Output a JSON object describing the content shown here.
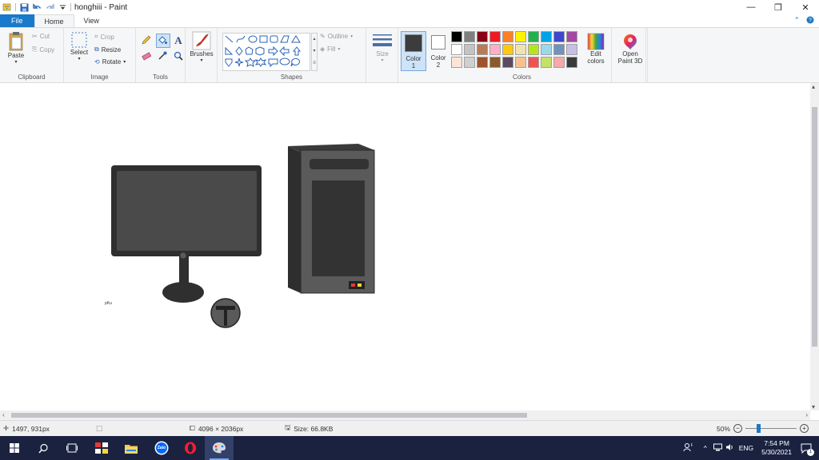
{
  "app": {
    "title": "honghiii - Paint"
  },
  "quick_access": {
    "icons": [
      "paint-app-icon",
      "save-icon",
      "undo-icon",
      "redo-icon",
      "customize-icon"
    ]
  },
  "window_controls": {
    "minimize": "—",
    "restore": "❐",
    "close": "✕"
  },
  "tabs": [
    {
      "label": "File"
    },
    {
      "label": "Home"
    },
    {
      "label": "View"
    }
  ],
  "ribbon": {
    "clipboard": {
      "label": "Clipboard",
      "paste": "Paste",
      "cut": "Cut",
      "copy": "Copy"
    },
    "image": {
      "label": "Image",
      "select": "Select",
      "crop": "Crop",
      "resize": "Resize",
      "rotate": "Rotate"
    },
    "tools": {
      "label": "Tools"
    },
    "brushes": {
      "label": "Brushes"
    },
    "shapes": {
      "label": "Shapes",
      "outline": "Outline",
      "fill": "Fill"
    },
    "size": {
      "label": "Size"
    },
    "colors": {
      "label": "Colors",
      "color1": "Color",
      "color1_num": "1",
      "color2": "Color",
      "color2_num": "2",
      "edit_colors_line1": "Edit",
      "edit_colors_line2": "colors",
      "color1_value": "#3c3c3c",
      "color2_value": "#ffffff",
      "swatches": [
        "#000000",
        "#7f7f7f",
        "#880015",
        "#ed1c24",
        "#ff7f27",
        "#fff200",
        "#22b14c",
        "#00a2e8",
        "#3f48cc",
        "#a349a4",
        "#ffffff",
        "#c3c3c3",
        "#b97a57",
        "#ffaec9",
        "#ffc90e",
        "#efe4b0",
        "#b5e61d",
        "#99d9ea",
        "#7092be",
        "#c8bfe7",
        "#fce4d6",
        "#cfcfcf",
        "#a0522d",
        "#8b5a2b",
        "#5e4a5e",
        "#f4c28f",
        "#ef5350",
        "#c6e06a",
        "#f7a8a8",
        "#3a3a3a"
      ]
    },
    "paint3d": {
      "line1": "Open",
      "line2": "Paint 3D"
    }
  },
  "canvas": {
    "small_label": "pKu"
  },
  "status": {
    "cursor": "1497, 931px",
    "dimensions": "4096 × 2036px",
    "size": "Size: 66.8KB",
    "zoom": "50%"
  },
  "taskbar": {
    "time": "7:54 PM",
    "date": "5/30/2021",
    "lang": "ENG",
    "notif_count": "1",
    "zalo_label": "Zalo"
  }
}
